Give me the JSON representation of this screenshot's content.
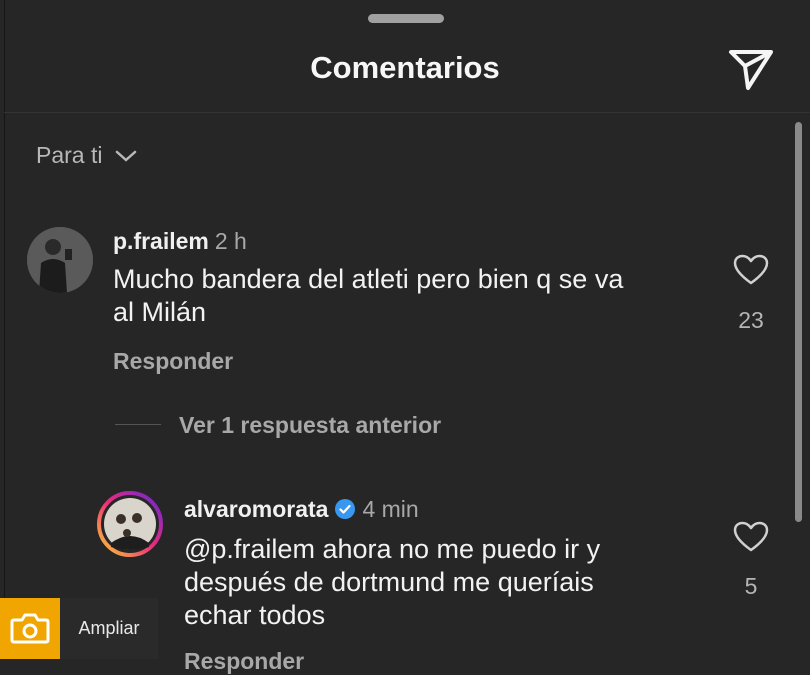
{
  "header": {
    "title": "Comentarios"
  },
  "filter": {
    "label": "Para ti"
  },
  "comments": [
    {
      "user": "p.frailem",
      "time": "2 h",
      "lines": [
        "Mucho bandera del atleti pero bien q se va",
        "al Milán"
      ],
      "likes": "23",
      "reply_label": "Responder"
    },
    {
      "user": "alvaromorata",
      "time": "4 min",
      "lines": [
        "@p.frailem  ahora no me puedo ir y",
        "después de dortmund me queríais",
        "echar todos"
      ],
      "likes": "5",
      "reply_label": "Responder"
    }
  ],
  "view_replies": "Ver 1 respuesta anterior",
  "overlay": {
    "label": "Ampliar"
  },
  "colors": {
    "background": "#262626",
    "text": "#f5f5f5",
    "muted": "#a8a8a8",
    "verified": "#3897f0",
    "overlay_accent": "#f0a500"
  }
}
